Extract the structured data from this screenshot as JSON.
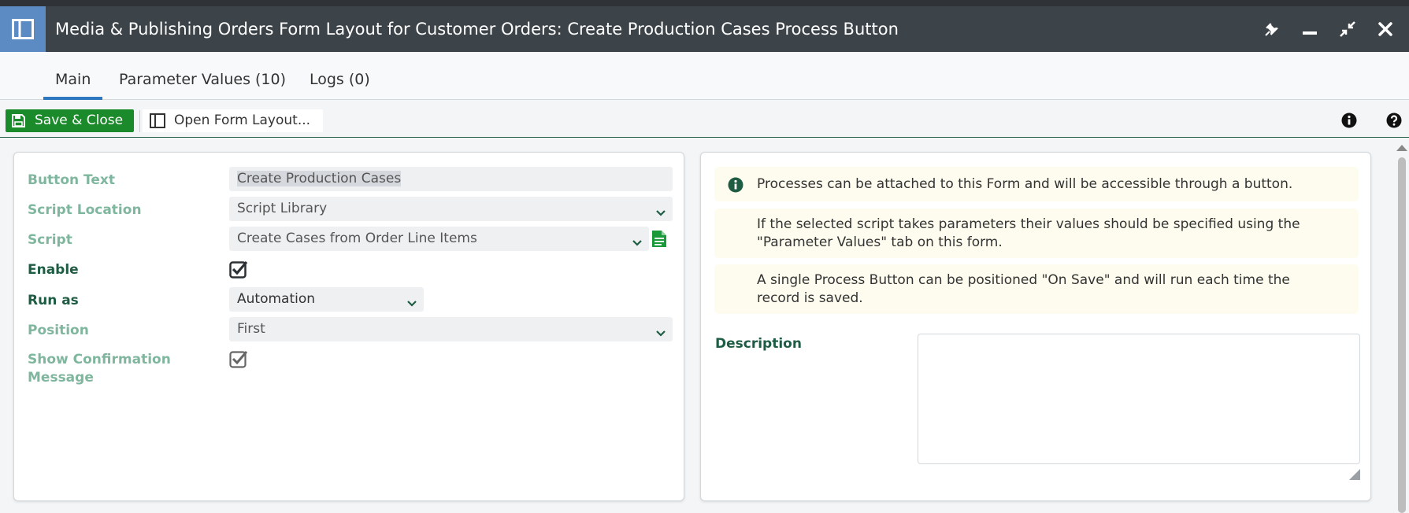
{
  "window": {
    "title": "Media & Publishing Orders Form Layout for Customer Orders: Create Production Cases Process Button",
    "icon": "layout-panel-icon",
    "controls": [
      "pin-icon",
      "minimize-icon",
      "restore-icon",
      "close-icon"
    ]
  },
  "tabs": [
    {
      "label": "Main",
      "active": true
    },
    {
      "label": "Parameter Values (10)",
      "active": false
    },
    {
      "label": "Logs (0)",
      "active": false
    }
  ],
  "toolbar": {
    "save_close_label": "Save & Close",
    "open_form_layout_label": "Open Form Layout...",
    "right_icons": [
      "info-icon",
      "help-icon"
    ]
  },
  "form": {
    "button_text": {
      "label": "Button Text",
      "value": "Create Production Cases"
    },
    "script_location": {
      "label": "Script Location",
      "value": "Script Library"
    },
    "script": {
      "label": "Script",
      "value": "Create Cases from Order Line Items"
    },
    "enable": {
      "label": "Enable",
      "checked": true
    },
    "run_as": {
      "label": "Run as",
      "value": "Automation"
    },
    "position": {
      "label": "Position",
      "value": "First"
    },
    "show_confirmation": {
      "label_line1": "Show Confirmation",
      "label_line2": "Message",
      "checked": true
    }
  },
  "info": {
    "line1": "Processes can be attached to this Form and will be accessible through a button.",
    "line2a": "If the selected script takes parameters their values should be specified using the",
    "line2b": "\"Parameter Values\" tab on this form.",
    "line3a": "A single Process Button can be positioned \"On Save\" and will run each time the",
    "line3b": "record is saved."
  },
  "description": {
    "label": "Description",
    "value": ""
  },
  "colors": {
    "titlebar": "#3c4349",
    "accent_blue": "#2e77c1",
    "save_green": "#1a8a2a",
    "label_green": "#1e5c44",
    "label_light_green": "#7fb69e"
  }
}
